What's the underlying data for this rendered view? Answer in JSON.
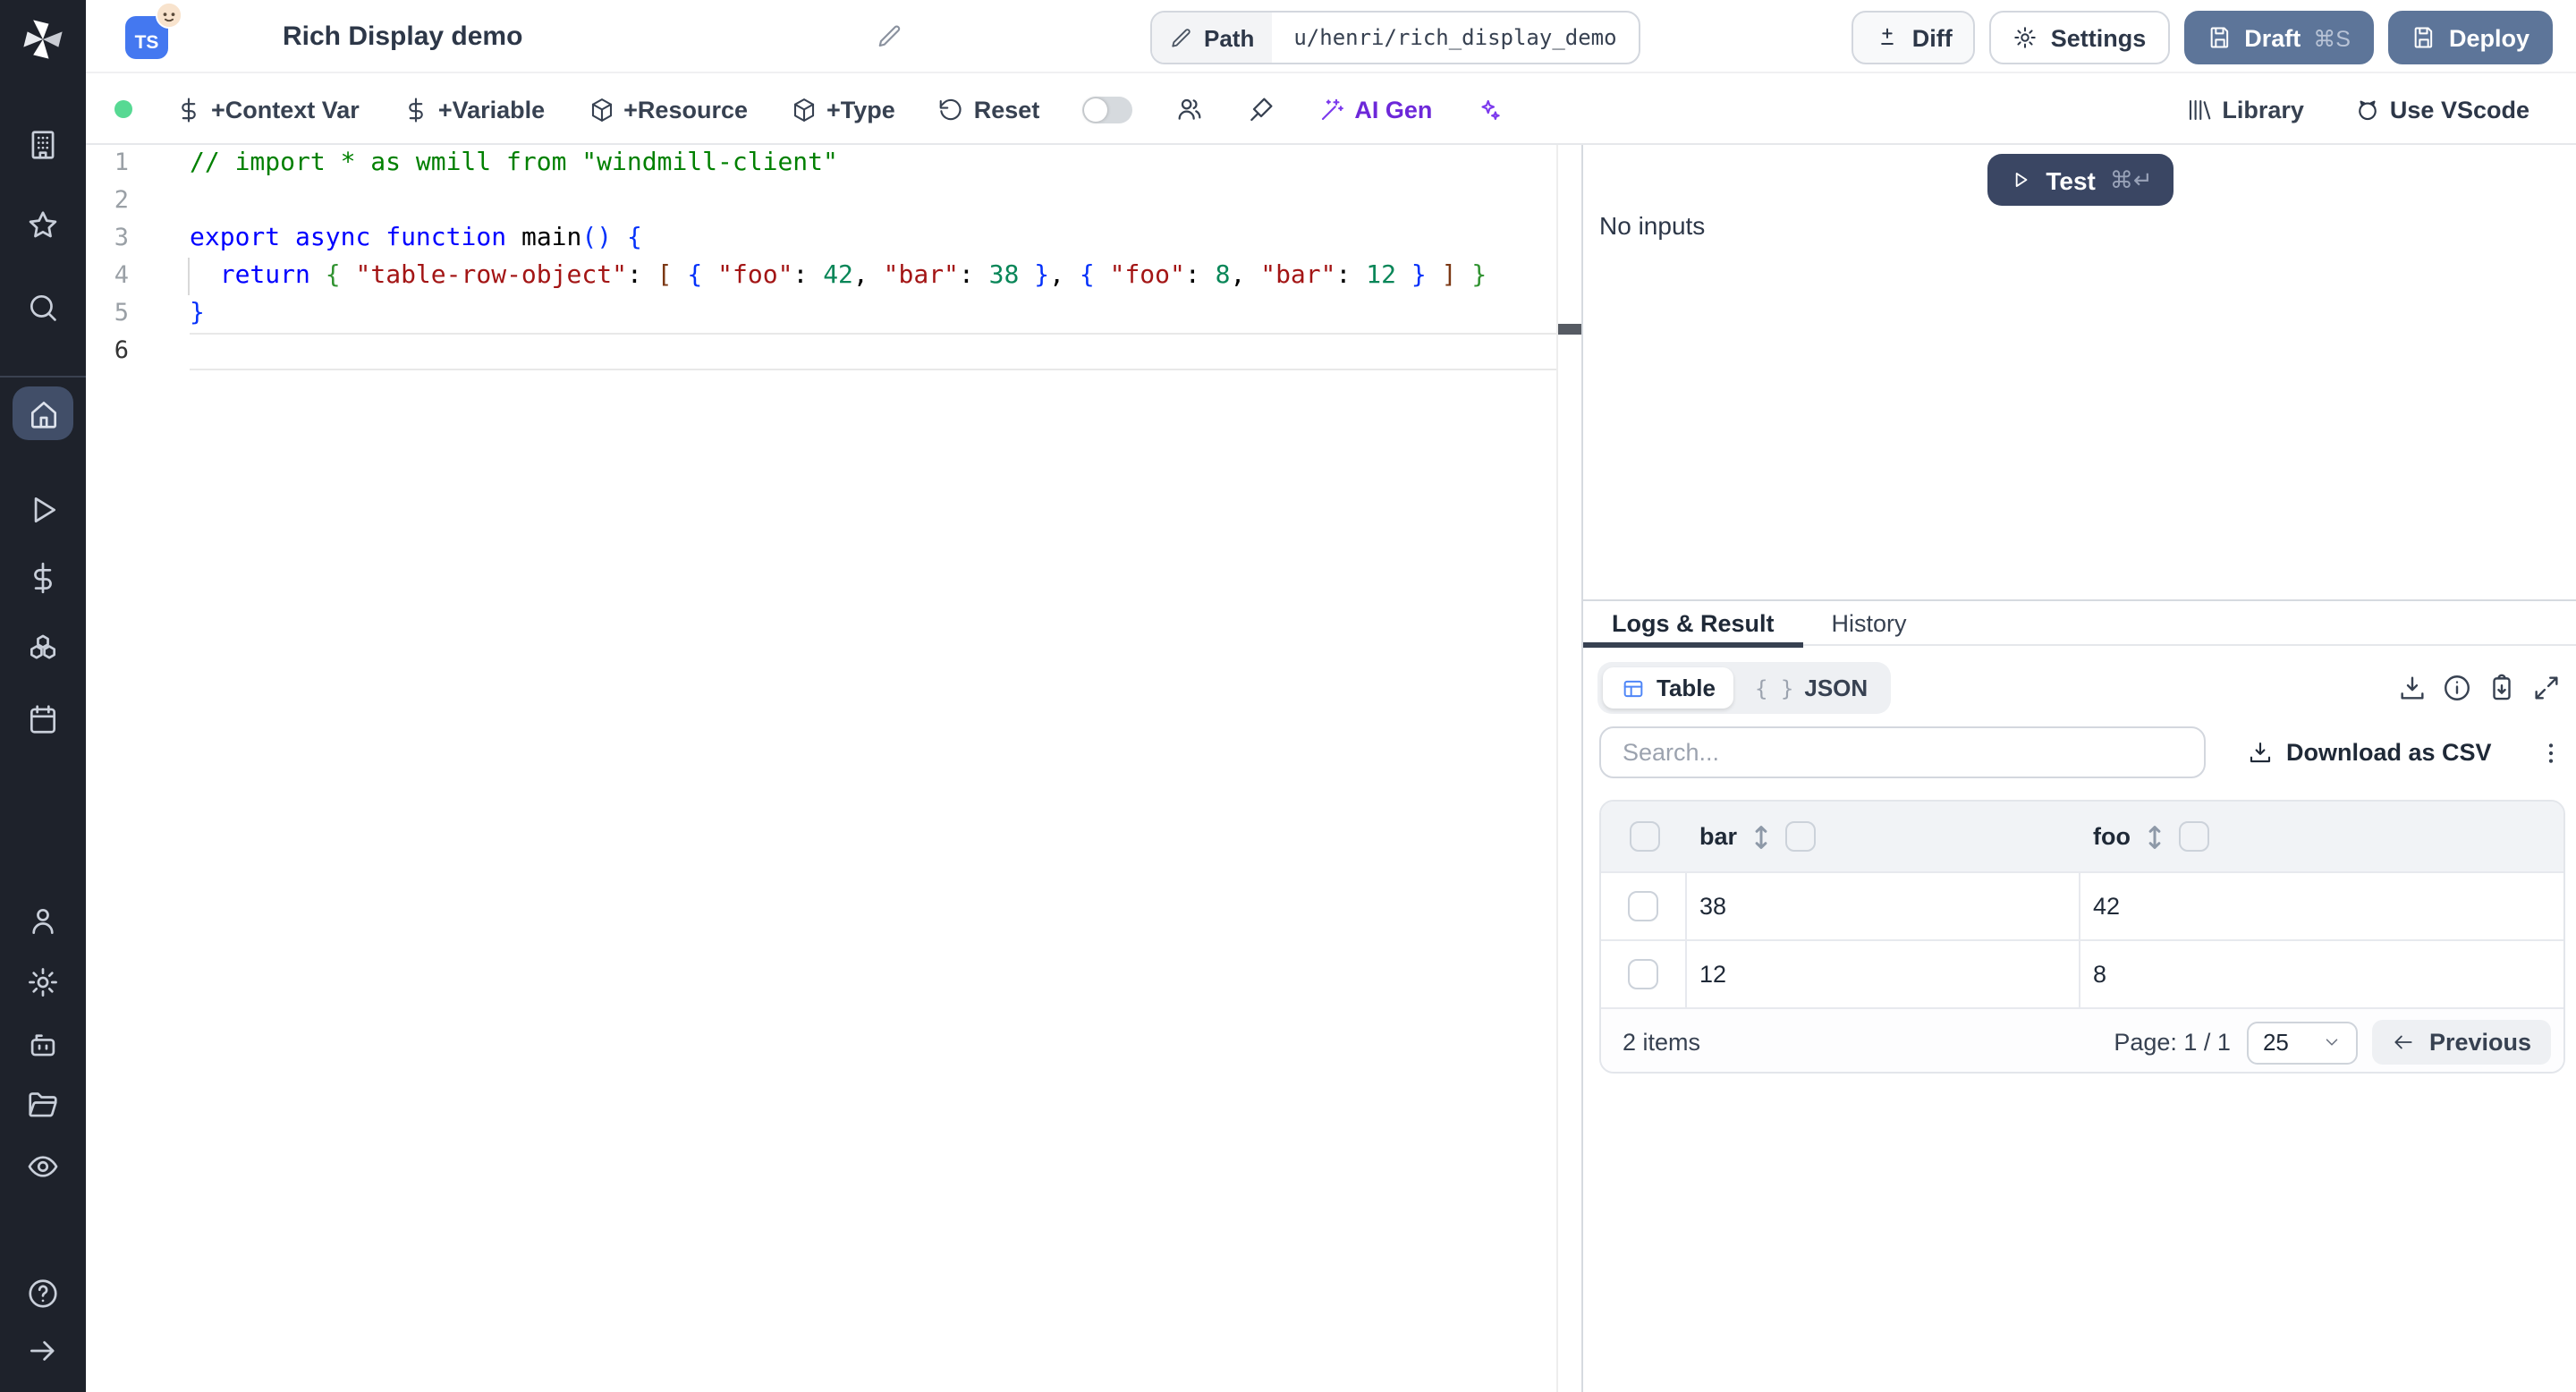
{
  "app": {
    "name": "Windmill"
  },
  "colors": {
    "sidebar_bg": "#1e222b",
    "active_item_bg": "#414e68",
    "slate_button": "#5d7599",
    "test_button": "#3a4663",
    "ts_badge_blue": "#4478f0",
    "ai_purple": "#6d28d9",
    "status_green": "#57d993",
    "table_icon_blue": "#4f86f7"
  },
  "header": {
    "language_badge": "TS",
    "title": "Rich Display demo",
    "path_label": "Path",
    "path_value": "u/henri/rich_display_demo",
    "diff_label": "Diff",
    "settings_label": "Settings",
    "draft_label": "Draft",
    "draft_shortcut": "⌘S",
    "deploy_label": "Deploy"
  },
  "toolbar": {
    "items": [
      "+Context Var",
      "+Variable",
      "+Resource",
      "+Type",
      "Reset"
    ],
    "ai_gen_label": "AI Gen",
    "library_label": "Library",
    "vscode_label": "Use VScode"
  },
  "editor": {
    "lines": [
      {
        "num": "1",
        "active": false,
        "tokens": [
          [
            "c",
            "// import * as wmill from \"windmill-client\""
          ]
        ]
      },
      {
        "num": "2",
        "active": false,
        "tokens": []
      },
      {
        "num": "3",
        "active": false,
        "tokens": [
          [
            "k",
            "export"
          ],
          [
            "p",
            " "
          ],
          [
            "k",
            "async"
          ],
          [
            "p",
            " "
          ],
          [
            "k",
            "function"
          ],
          [
            "p",
            " "
          ],
          [
            "p",
            "main"
          ],
          [
            "b1",
            "()"
          ],
          [
            "p",
            " "
          ],
          [
            "b1",
            "{"
          ]
        ]
      },
      {
        "num": "4",
        "active": false,
        "tokens": [
          [
            "p",
            "  "
          ],
          [
            "k",
            "return"
          ],
          [
            "p",
            " "
          ],
          [
            "b2",
            "{"
          ],
          [
            "p",
            " "
          ],
          [
            "s",
            "\"table-row-object\""
          ],
          [
            "p",
            ": "
          ],
          [
            "b3",
            "["
          ],
          [
            "p",
            " "
          ],
          [
            "b1",
            "{"
          ],
          [
            "p",
            " "
          ],
          [
            "s",
            "\"foo\""
          ],
          [
            "p",
            ": "
          ],
          [
            "n",
            "42"
          ],
          [
            "p",
            ", "
          ],
          [
            "s",
            "\"bar\""
          ],
          [
            "p",
            ": "
          ],
          [
            "n",
            "38"
          ],
          [
            "p",
            " "
          ],
          [
            "b1",
            "}"
          ],
          [
            "p",
            ", "
          ],
          [
            "b1",
            "{"
          ],
          [
            "p",
            " "
          ],
          [
            "s",
            "\"foo\""
          ],
          [
            "p",
            ": "
          ],
          [
            "n",
            "8"
          ],
          [
            "p",
            ", "
          ],
          [
            "s",
            "\"bar\""
          ],
          [
            "p",
            ": "
          ],
          [
            "n",
            "12"
          ],
          [
            "p",
            " "
          ],
          [
            "b1",
            "}"
          ],
          [
            "p",
            " "
          ],
          [
            "b3",
            "]"
          ],
          [
            "p",
            " "
          ],
          [
            "b2",
            "}"
          ]
        ]
      },
      {
        "num": "5",
        "active": false,
        "tokens": [
          [
            "b1",
            "}"
          ]
        ]
      },
      {
        "num": "6",
        "active": true,
        "tokens": []
      }
    ]
  },
  "run_panel": {
    "test_label": "Test",
    "test_shortcut": "⌘↵",
    "no_inputs": "No inputs"
  },
  "result_panel": {
    "tabs": [
      {
        "label": "Logs & Result"
      },
      {
        "label": "History"
      }
    ],
    "views": [
      {
        "label": "Table"
      },
      {
        "label": "JSON"
      }
    ],
    "json_braces": "{ }",
    "search_placeholder": "Search...",
    "download_csv_label": "Download as CSV",
    "table": {
      "columns": [
        "bar",
        "foo"
      ],
      "rows": [
        [
          "38",
          "42"
        ],
        [
          "12",
          "8"
        ]
      ],
      "items_label": "2 items",
      "page_label": "Page: 1 / 1",
      "page_size": "25",
      "prev_label": "Previous"
    }
  }
}
